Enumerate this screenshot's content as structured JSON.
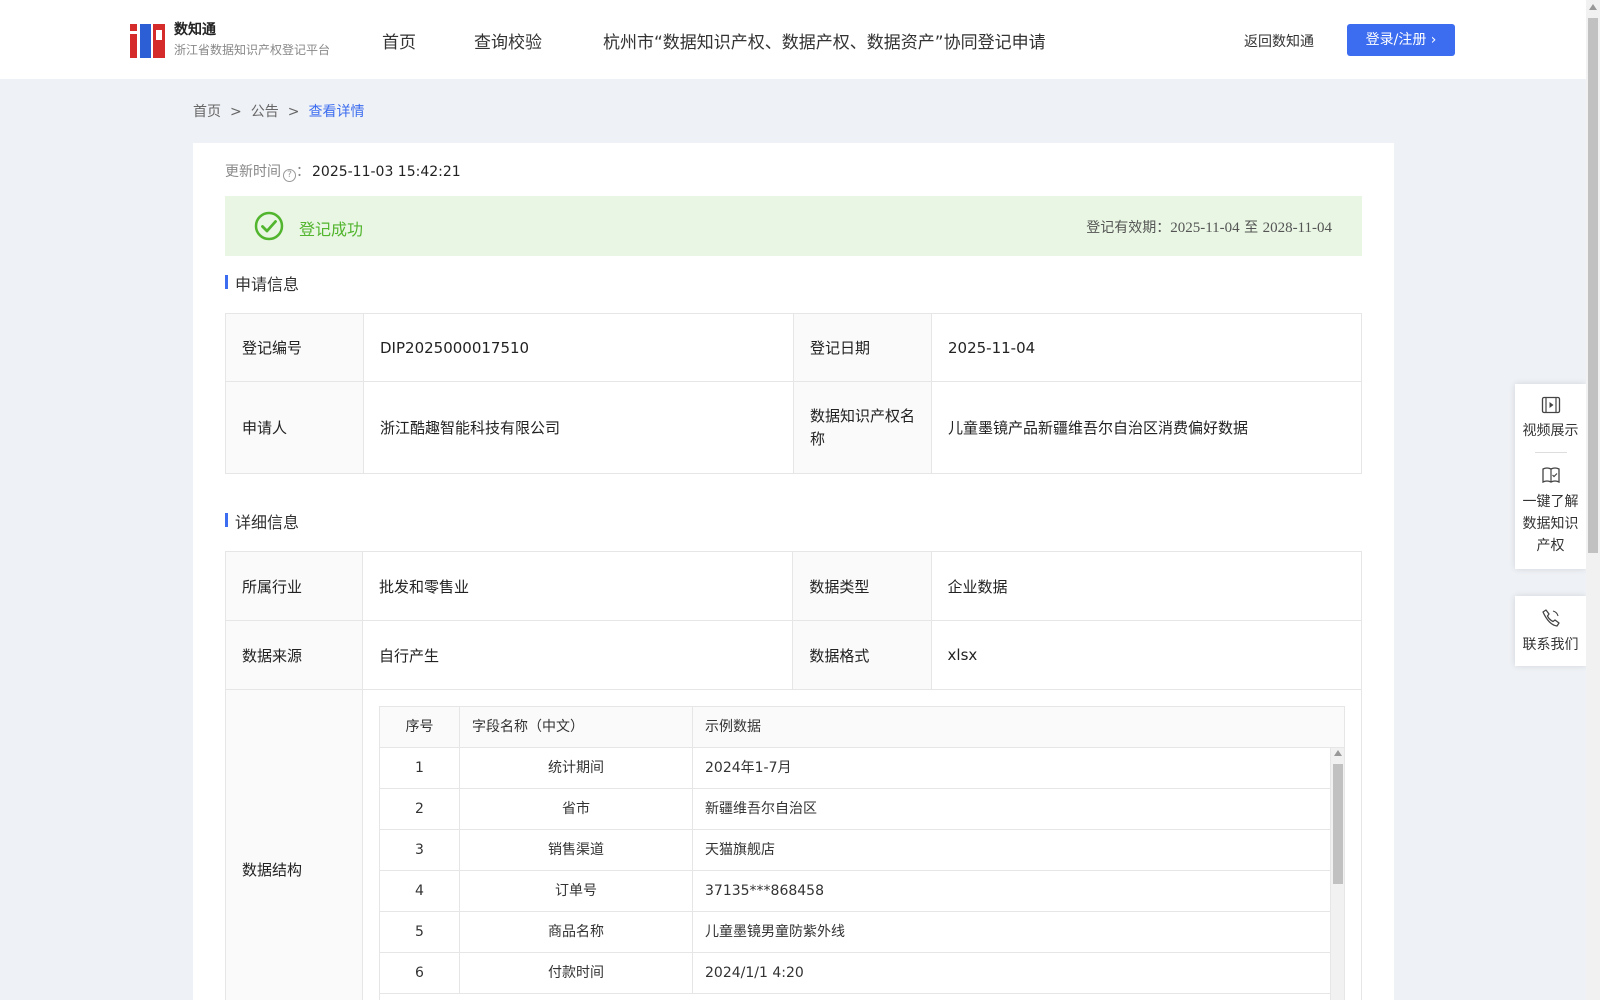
{
  "header": {
    "logo_title": "数知通",
    "logo_subtitle": "浙江省数据知识产权登记平台",
    "nav": [
      "首页",
      "查询校验",
      "杭州市“数据知识产权、数据产权、数据资产”协同登记申请"
    ],
    "back_link": "返回数知通",
    "login_button": "登录/注册"
  },
  "breadcrumb": {
    "items": [
      "首页",
      "公告",
      "查看详情"
    ],
    "separator": ">"
  },
  "update": {
    "label": "更新时间",
    "colon": "：",
    "value": "2025-11-03 15:42:21"
  },
  "status": {
    "text": "登记成功",
    "valid_label": "登记有效期：",
    "valid_from": "2025-11-04",
    "valid_to_word": "至",
    "valid_to": "2028-11-04",
    "color": "#52b52e"
  },
  "application": {
    "title": "申请信息",
    "rows": [
      {
        "k1": "登记编号",
        "v1": "DIP2025000017510",
        "k2": "登记日期",
        "v2": "2025-11-04"
      },
      {
        "k1": "申请人",
        "v1": "浙江酷趣智能科技有限公司",
        "k2": "数据知识产权名称",
        "v2": "儿童墨镜产品新疆维吾尔自治区消费偏好数据"
      }
    ]
  },
  "details": {
    "title": "详细信息",
    "rows": [
      {
        "k1": "所属行业",
        "v1": "批发和零售业",
        "k2": "数据类型",
        "v2": "企业数据"
      },
      {
        "k1": "数据来源",
        "v1": "自行产生",
        "k2": "数据格式",
        "v2": "xlsx"
      }
    ],
    "structure_label": "数据结构",
    "structure_headers": [
      "序号",
      "字段名称（中文）",
      "示例数据"
    ],
    "structure_rows": [
      {
        "no": "1",
        "name": "统计期间",
        "sample": "2024年1-7月"
      },
      {
        "no": "2",
        "name": "省市",
        "sample": "新疆维吾尔自治区"
      },
      {
        "no": "3",
        "name": "销售渠道",
        "sample": "天猫旗舰店"
      },
      {
        "no": "4",
        "name": "订单号",
        "sample": "37135***868458"
      },
      {
        "no": "5",
        "name": "商品名称",
        "sample": "儿童墨镜男童防紫外线"
      },
      {
        "no": "6",
        "name": "付款时间",
        "sample": "2024/1/1 4:20"
      }
    ]
  },
  "side_panel": {
    "video": "视频展示",
    "learn": [
      "一键了解",
      "数据知识",
      "产权"
    ],
    "contact": "联系我们"
  },
  "colors": {
    "accent": "#3c6df0",
    "success_bg": "#e8f6e3",
    "page_bg": "#eef1f5"
  }
}
